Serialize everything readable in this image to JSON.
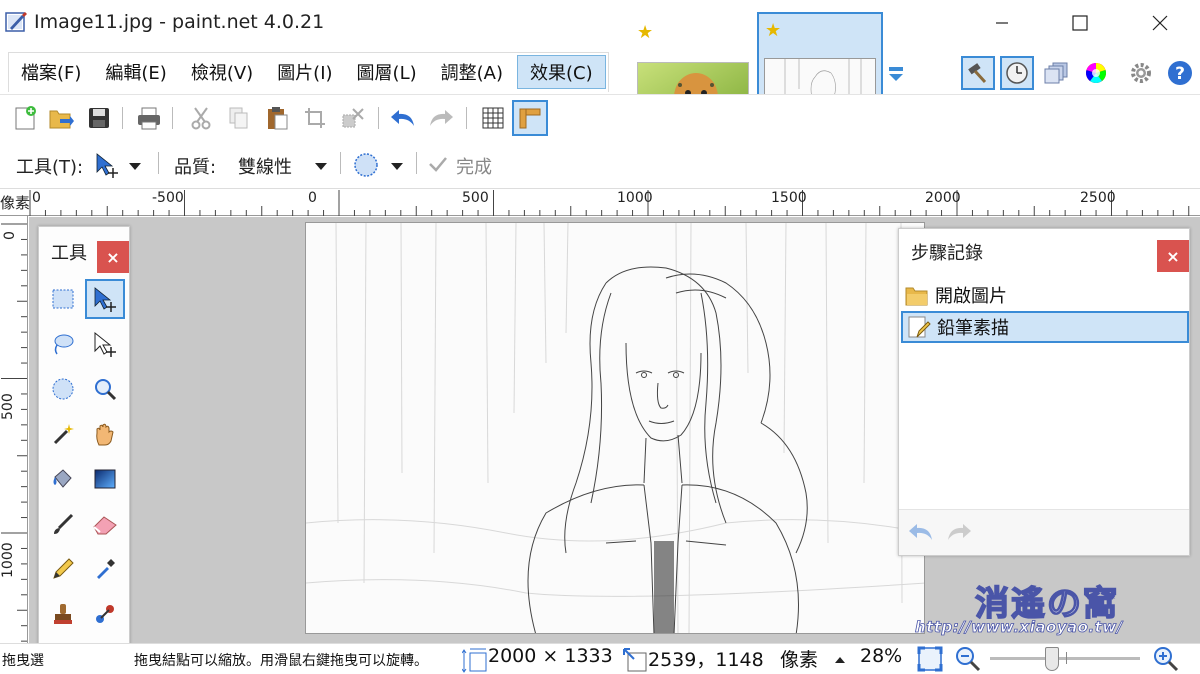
{
  "window": {
    "title": "Image11.jpg - paint.net 4.0.21"
  },
  "menu": {
    "items": [
      {
        "label": "檔案(F)",
        "active": false
      },
      {
        "label": "編輯(E)",
        "active": false
      },
      {
        "label": "檢視(V)",
        "active": false
      },
      {
        "label": "圖片(I)",
        "active": false
      },
      {
        "label": "圖層(L)",
        "active": false
      },
      {
        "label": "調整(A)",
        "active": false
      },
      {
        "label": "效果(C)",
        "active": true
      }
    ]
  },
  "tool_options": {
    "tool_label": "工具(T):",
    "quality_label": "品質:",
    "quality_value": "雙線性",
    "finish_label": "完成"
  },
  "ruler": {
    "unit": "像素",
    "h_ticks": [
      "0",
      "-500",
      "0",
      "500",
      "1000",
      "1500",
      "2000",
      "2500"
    ],
    "v_ticks": [
      "0",
      "500",
      "1000"
    ]
  },
  "tools_panel": {
    "title": "工具",
    "close": "×"
  },
  "history_panel": {
    "title": "步驟記錄",
    "close": "×",
    "items": [
      {
        "label": "開啟圖片",
        "selected": false
      },
      {
        "label": "鉛筆素描",
        "selected": true
      }
    ]
  },
  "status": {
    "hint_left": "拖曳選",
    "hint_right": "拖曳結點可以縮放。用滑鼠右鍵拖曳可以旋轉。",
    "image_size": "2000 × 1333",
    "cursor_pos": "2539，1148",
    "unit": "像素",
    "zoom": "28%",
    "zoom_level": 0.28
  },
  "watermark": {
    "line1": "消遙の窩",
    "line2": "http://www.xiaoyao.tw/"
  },
  "colors": {
    "accent": "#3a8bd6",
    "selection_bg": "#cfe4f7",
    "close_red": "#d9534f",
    "workspace": "#c8c8c8"
  }
}
